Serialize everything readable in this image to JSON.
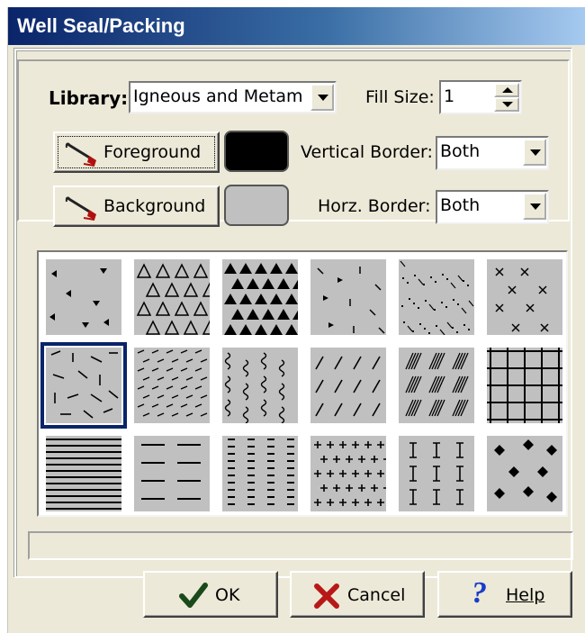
{
  "window": {
    "title": "Well Seal/Packing"
  },
  "library": {
    "label": "Library:",
    "value": "Igneous and Metam"
  },
  "fill_size": {
    "label": "Fill Size:",
    "value": "1"
  },
  "foreground": {
    "label": "Foreground",
    "color": "#000000"
  },
  "background": {
    "label": "Background",
    "color": "#c0c0c0"
  },
  "vertical_border": {
    "label": "Vertical Border:",
    "value": "Both"
  },
  "horz_border": {
    "label": "Horz. Border:",
    "value": "Both"
  },
  "patterns": {
    "selected_index": 6,
    "tile_fill": "#c0c0c0",
    "items": [
      "sparse-triangles",
      "open-triangles",
      "solid-triangles",
      "scattered-marks",
      "dots-and-ticks",
      "x-marks",
      "random-dashes",
      "dense-dashes",
      "wavy-squiggles",
      "diagonal-dashes",
      "hatched-lenses",
      "square-grid",
      "horizontal-lines",
      "short-horizontal-dashes",
      "dense-short-dashes",
      "plus-marks",
      "i-marks",
      "diamonds"
    ]
  },
  "buttons": {
    "ok": "OK",
    "cancel": "Cancel",
    "help": "Help"
  }
}
